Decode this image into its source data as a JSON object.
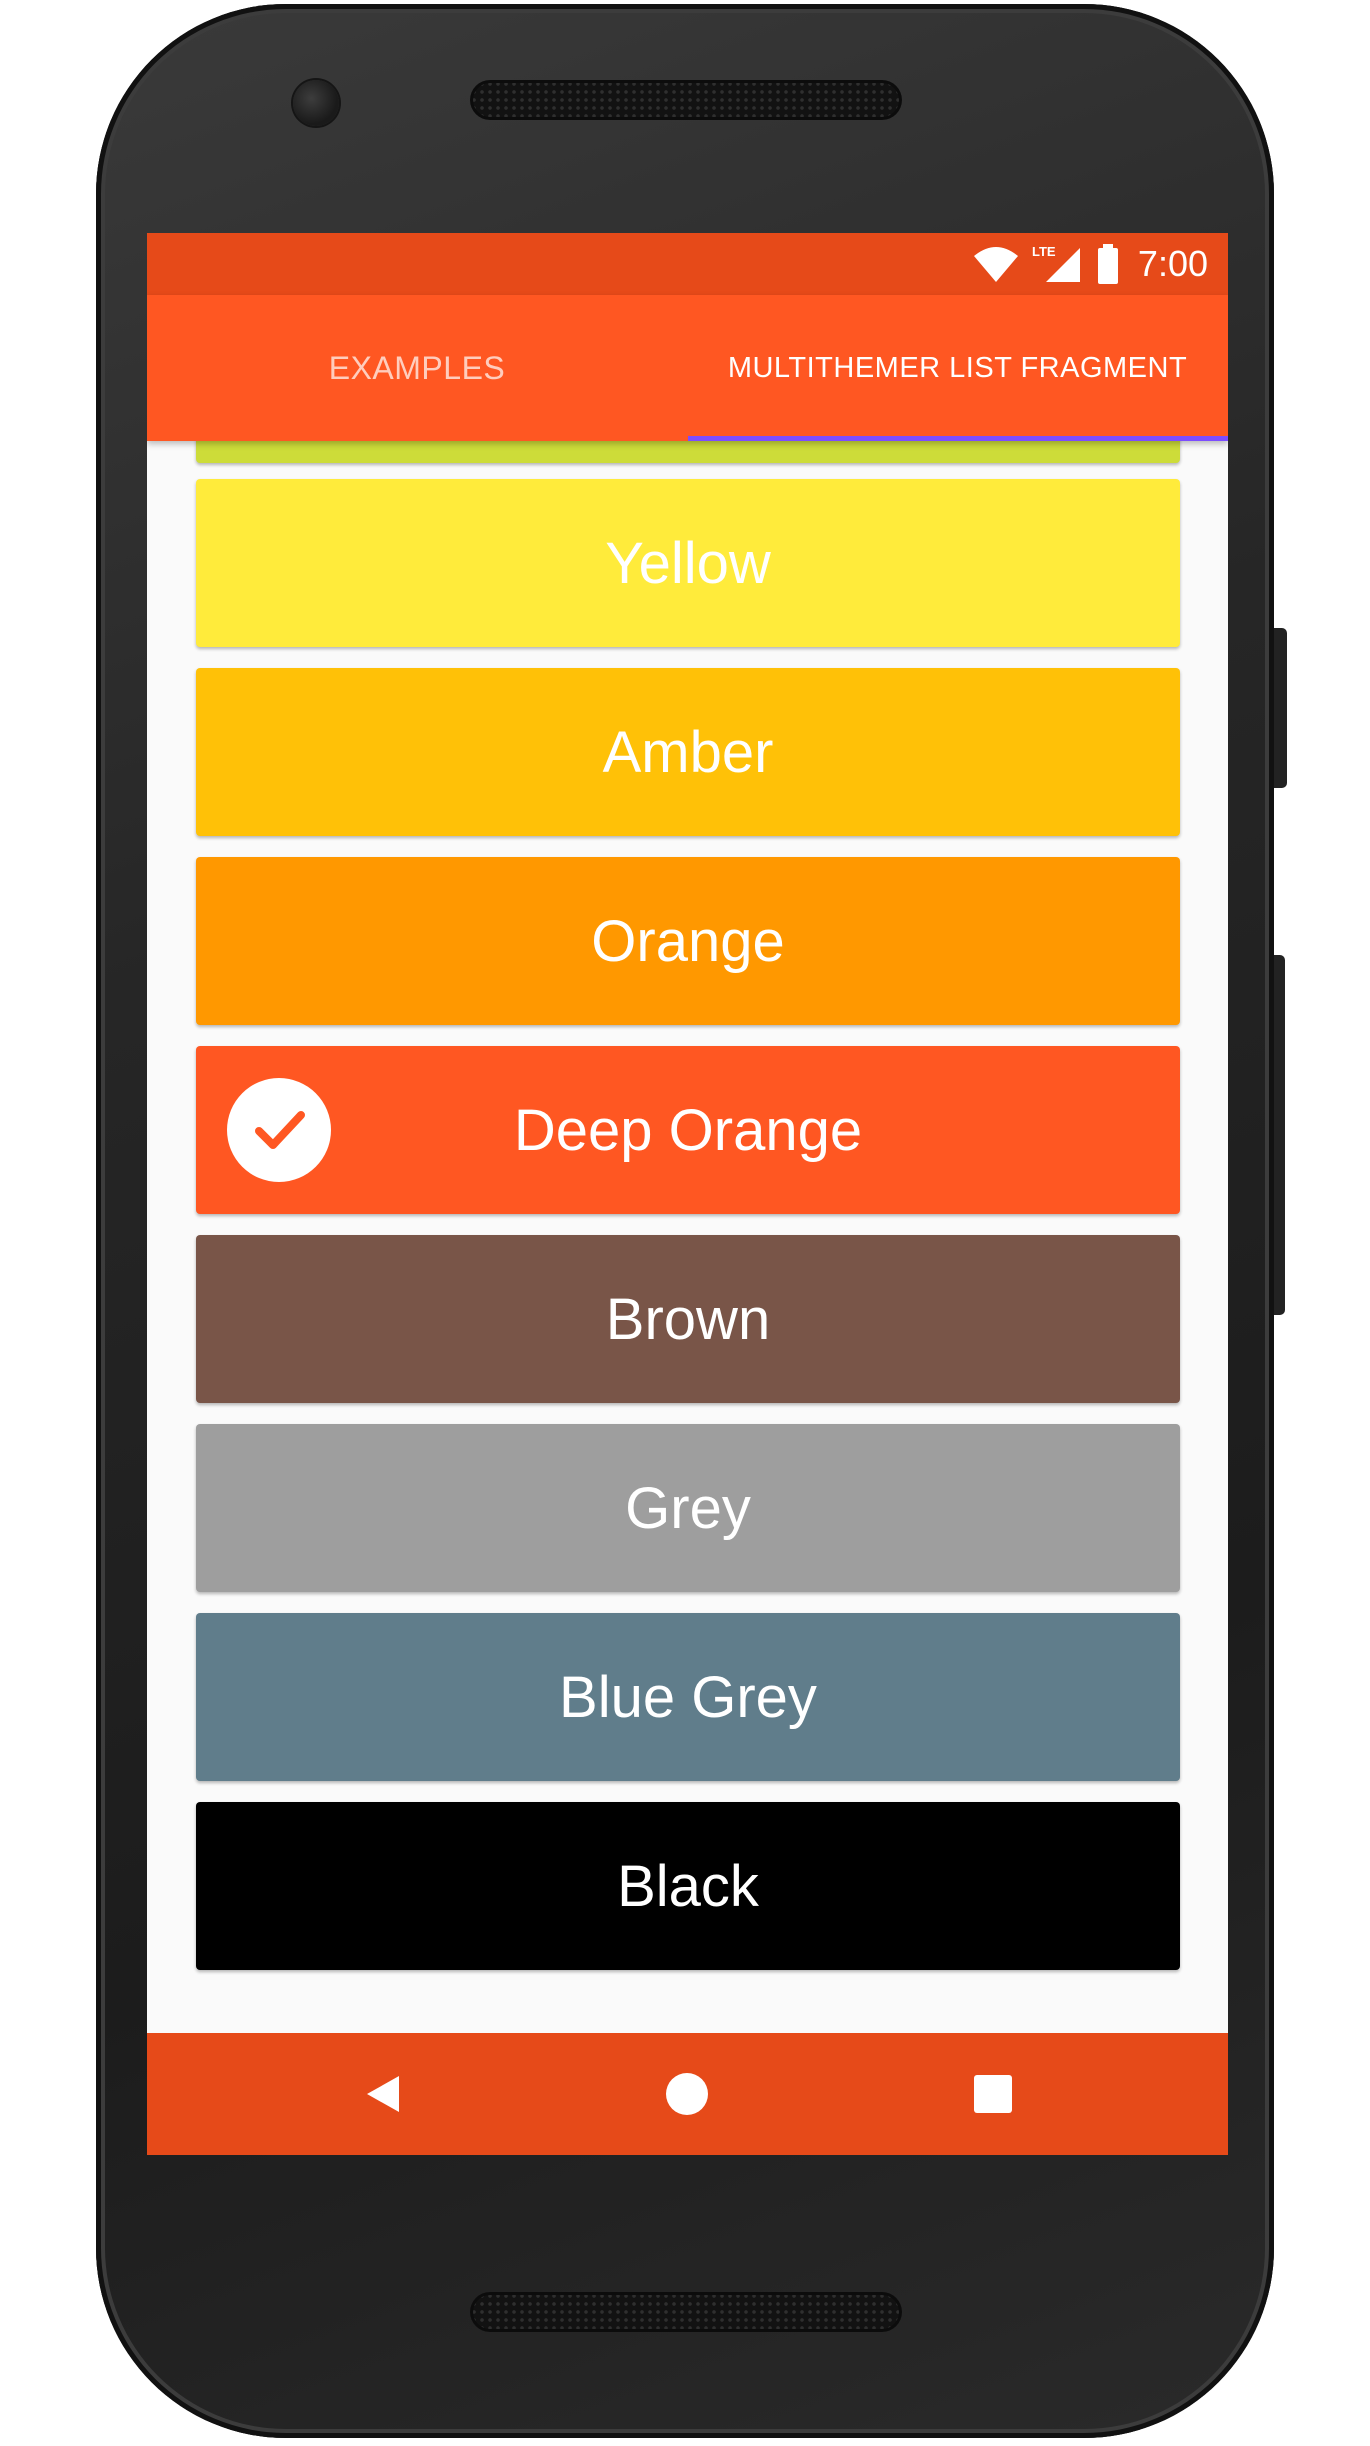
{
  "status_bar": {
    "time": "7:00",
    "network_label": "LTE",
    "icons": [
      "wifi-icon",
      "lte-signal-icon",
      "battery-icon"
    ]
  },
  "tabs": [
    {
      "label": "EXAMPLES",
      "selected": false
    },
    {
      "label": "MULTITHEMER LIST FRAGMENT",
      "selected": true
    }
  ],
  "colors": {
    "status_bar": "#e64a19",
    "app_bar": "#ff5722",
    "tab_indicator": "#7c4dff",
    "nav_bar": "#e64a19",
    "background": "#fafafa"
  },
  "themes": [
    {
      "name": "",
      "color": "#cddc39",
      "partial": true
    },
    {
      "name": "Yellow",
      "color": "#ffeb3b"
    },
    {
      "name": "Amber",
      "color": "#ffc107"
    },
    {
      "name": "Orange",
      "color": "#ff9800"
    },
    {
      "name": "Deep Orange",
      "color": "#ff5722",
      "selected": true
    },
    {
      "name": "Brown",
      "color": "#795548"
    },
    {
      "name": "Grey",
      "color": "#9e9e9e"
    },
    {
      "name": "Blue Grey",
      "color": "#607d8b"
    },
    {
      "name": "Black",
      "color": "#000000"
    }
  ],
  "nav_bar": {
    "icons": [
      "back-icon",
      "home-icon",
      "recents-icon"
    ]
  }
}
